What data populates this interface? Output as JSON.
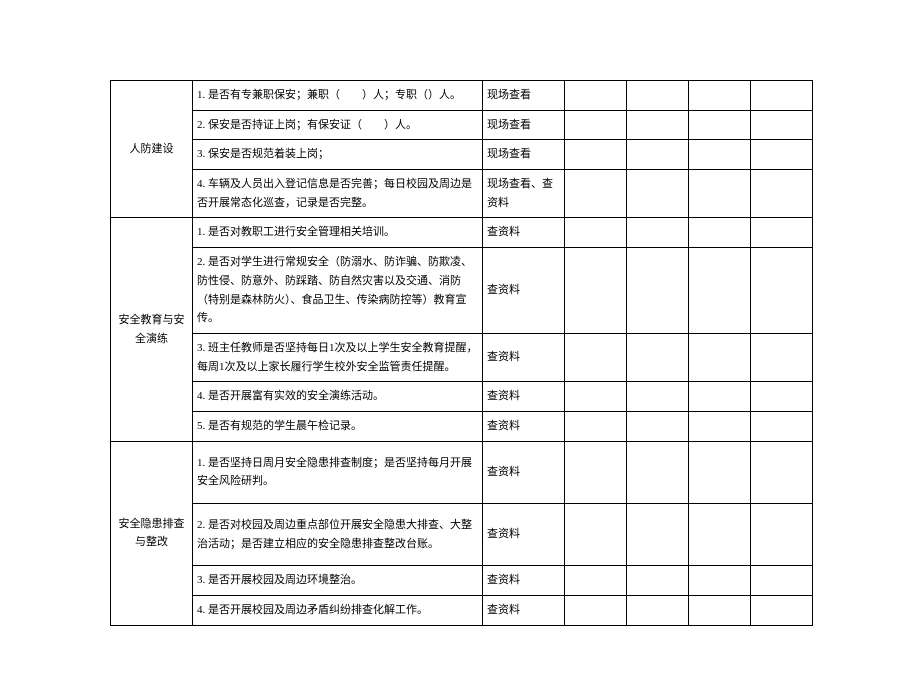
{
  "sections": [
    {
      "category": "人防建设",
      "rows": [
        {
          "item": "1. 是否有专兼职保安；兼职（　　）人；专职（）人。",
          "method": "现场查看"
        },
        {
          "item": "2. 保安是否持证上岗；有保安证（　　）人。",
          "method": "现场查看"
        },
        {
          "item": "3. 保安是否规范着装上岗；",
          "method": "现场查看"
        },
        {
          "item": "4. 车辆及人员出入登记信息是否完善；每日校园及周边是否开展常态化巡查，记录是否完整。",
          "method": "现场查看、查资料"
        }
      ]
    },
    {
      "category": "安全教育与安全演练",
      "rows": [
        {
          "item": "1. 是否对教职工进行安全管理相关培训。",
          "method": "查资料"
        },
        {
          "item": "2. 是否对学生进行常规安全（防溺水、防诈骗、防欺凌、防性侵、防意外、防踩踏、防自然灾害以及交通、消防（特别是森林防火）、食品卫生、传染病防控等）教育宣传。",
          "method": "查资料"
        },
        {
          "item": "3. 班主任教师是否坚持每日1次及以上学生安全教育提醒，每周1次及以上家长履行学生校外安全监管责任提醒。",
          "method": "查资料"
        },
        {
          "item": "4. 是否开展富有实效的安全演练活动。",
          "method": "查资料"
        },
        {
          "item": "5. 是否有规范的学生晨午检记录。",
          "method": "查资料"
        }
      ]
    },
    {
      "category": "安全隐患排查与整改",
      "rows": [
        {
          "item": "1. 是否坚持日周月安全隐患排查制度；是否坚持每月开展安全风险研判。",
          "method": "查资料"
        },
        {
          "item": "2. 是否对校园及周边重点部位开展安全隐患大排查、大整治活动；是否建立相应的安全隐患排查整改台账。",
          "method": "查资料"
        },
        {
          "item": "3. 是否开展校园及周边环境整治。",
          "method": "查资料"
        },
        {
          "item": "4. 是否开展校园及周边矛盾纠纷排查化解工作。",
          "method": "查资料"
        }
      ]
    }
  ]
}
